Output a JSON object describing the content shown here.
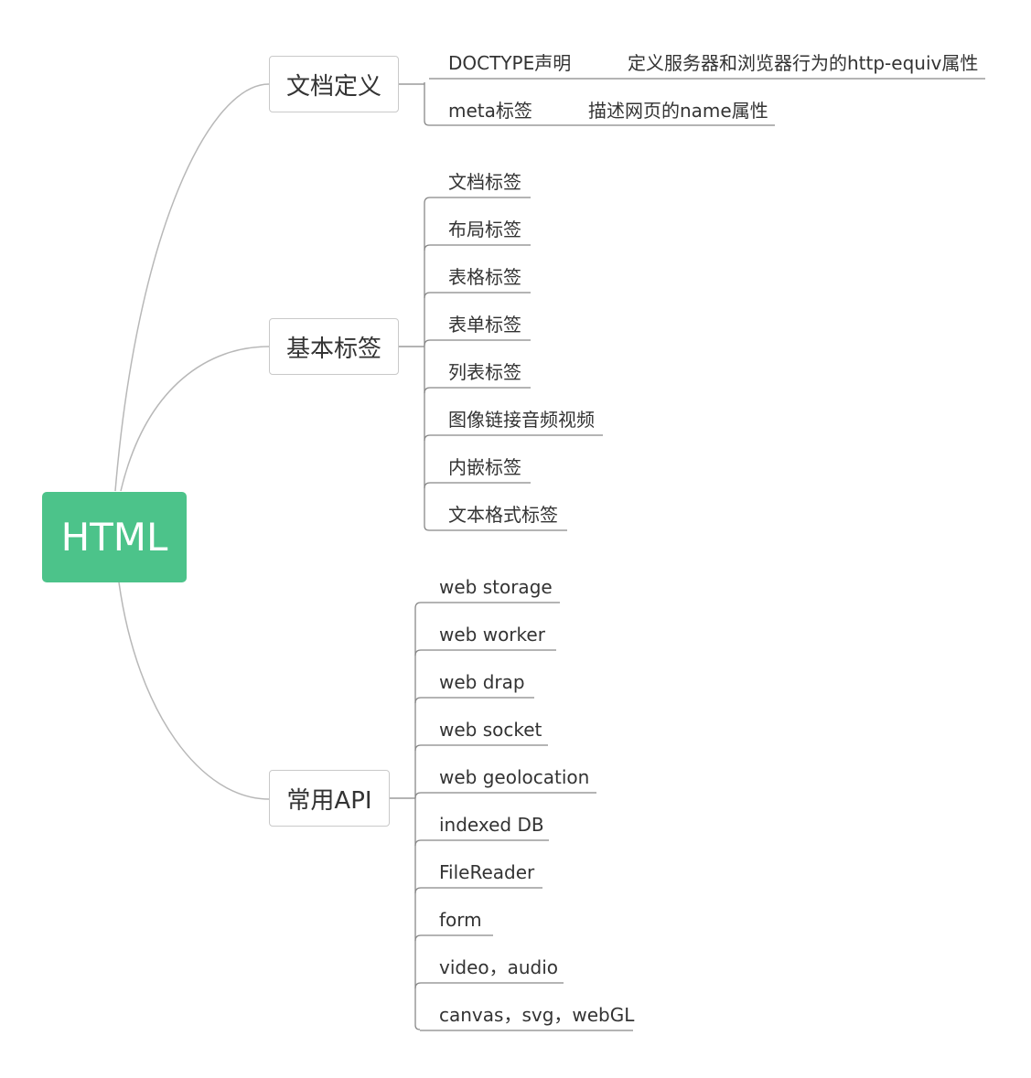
{
  "mindmap": {
    "root": "HTML",
    "branches": [
      {
        "label": "文档定义",
        "children": [
          {
            "label": "DOCTYPE声明",
            "children": [
              "定义服务器和浏览器行为的http-equiv属性"
            ]
          },
          {
            "label": "meta标签",
            "children": [
              "描述网页的name属性"
            ]
          }
        ]
      },
      {
        "label": "基本标签",
        "children": [
          {
            "label": "文档标签"
          },
          {
            "label": "布局标签"
          },
          {
            "label": "表格标签"
          },
          {
            "label": "表单标签"
          },
          {
            "label": "列表标签"
          },
          {
            "label": "图像链接音频视频"
          },
          {
            "label": "内嵌标签"
          },
          {
            "label": "文本格式标签"
          }
        ]
      },
      {
        "label": "常用API",
        "children": [
          {
            "label": "web storage"
          },
          {
            "label": "web worker"
          },
          {
            "label": "web drap"
          },
          {
            "label": "web socket"
          },
          {
            "label": "web geolocation"
          },
          {
            "label": "indexed DB"
          },
          {
            "label": "FileReader"
          },
          {
            "label": "form"
          },
          {
            "label": "video，audio"
          },
          {
            "label": "canvas，svg，webGL"
          }
        ]
      }
    ]
  },
  "colors": {
    "root_fill": "#4cc38a",
    "curve_stroke": "#b8b8b8",
    "bracket_stroke": "#888888",
    "text": "#333333"
  }
}
